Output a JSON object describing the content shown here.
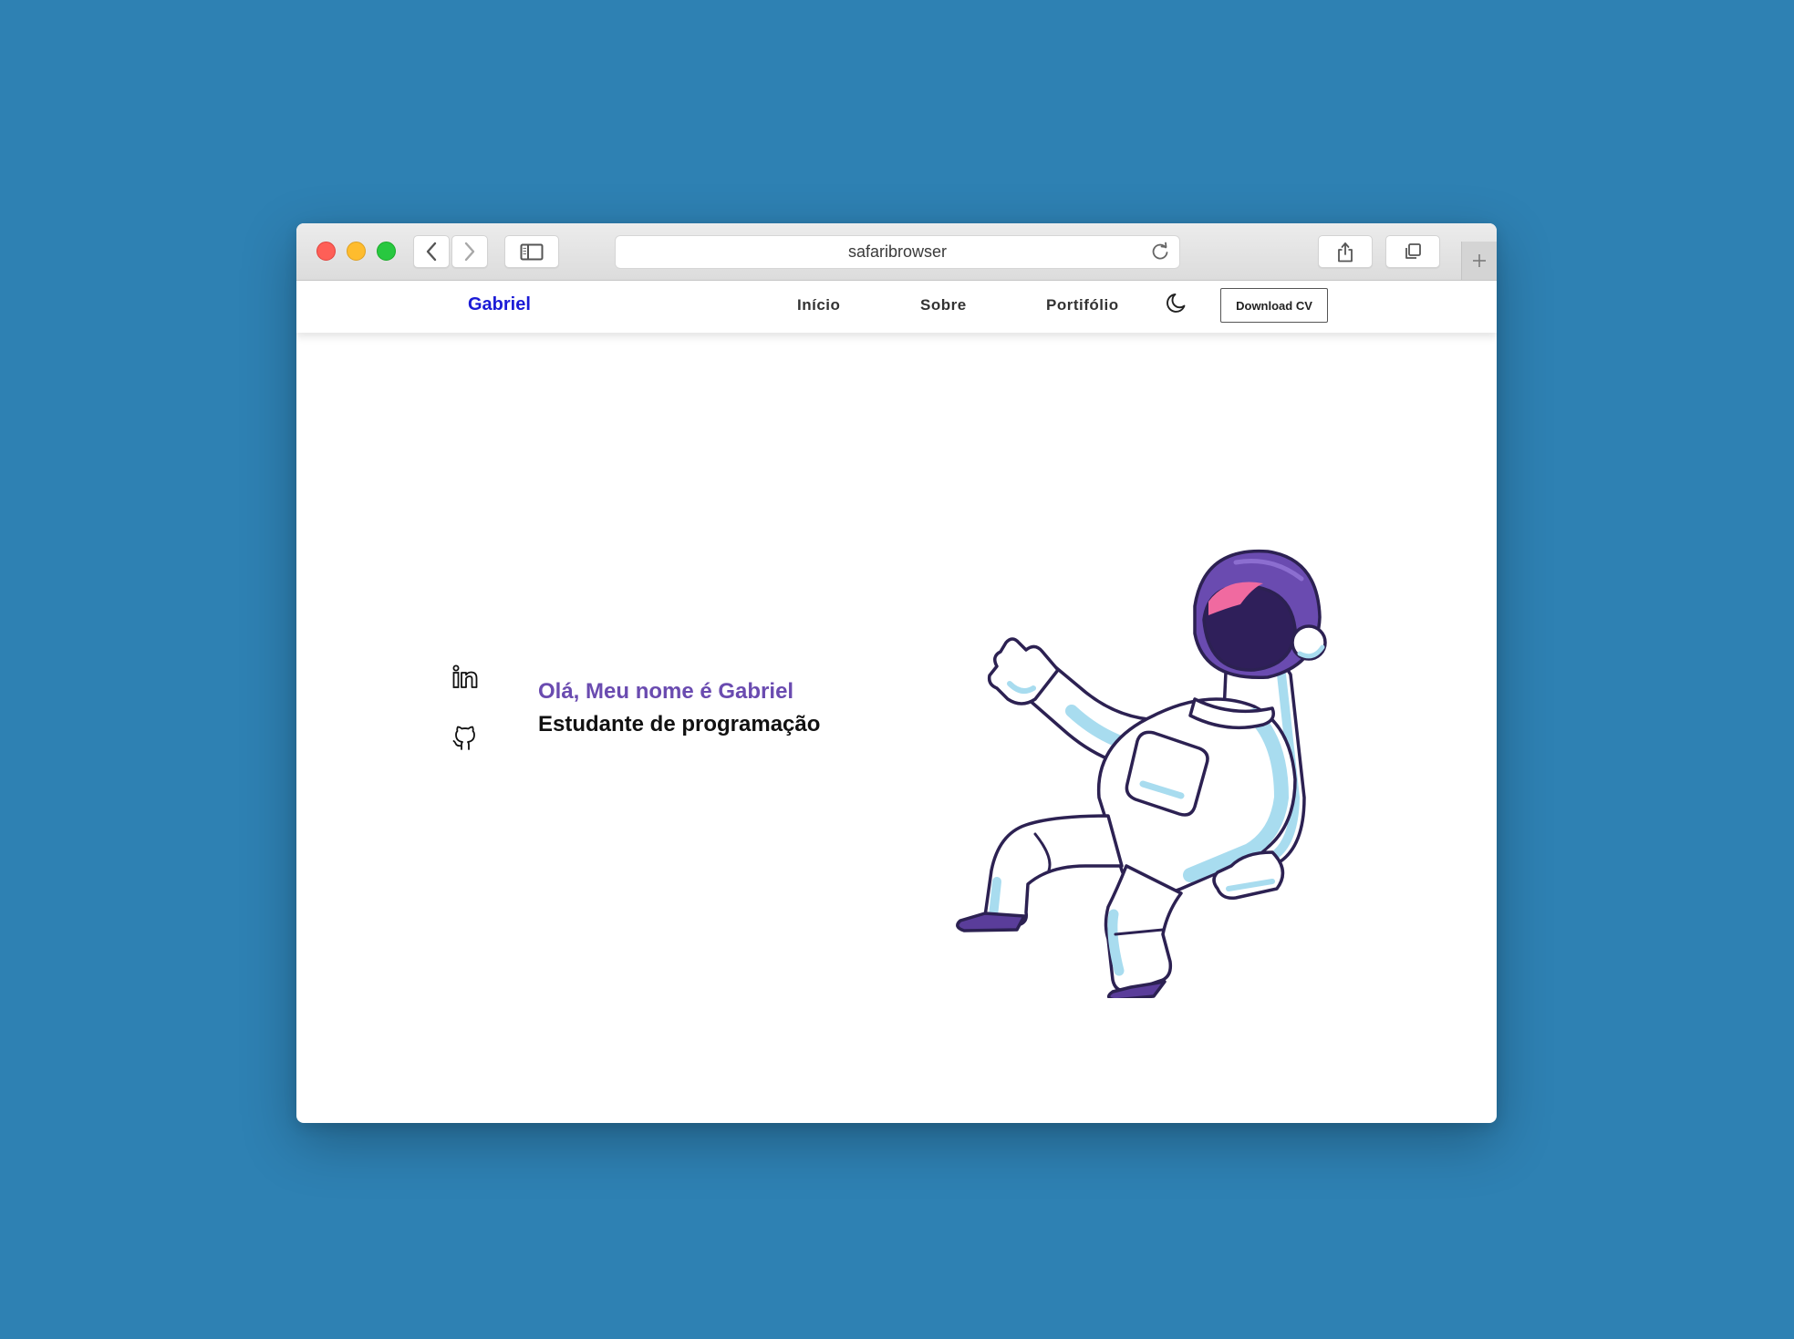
{
  "browser": {
    "url": "safaribrowser"
  },
  "site": {
    "logo": "Gabriel",
    "nav": [
      {
        "label": "Início"
      },
      {
        "label": "Sobre"
      },
      {
        "label": "Portifólio"
      }
    ],
    "cv_button": "Download CV"
  },
  "hero": {
    "greeting": "Olá, Meu nome é Gabriel",
    "subtitle": "Estudante de programação"
  },
  "icons": {
    "social": [
      "linkedin-icon",
      "github-icon"
    ],
    "theme_toggle": "moon-icon",
    "illustration": "astronaut-illustration"
  },
  "colors": {
    "page_background": "#2e81b3",
    "logo": "#1b1bd6",
    "greeting": "#6a4bb0",
    "helmet": "#6a4bb0",
    "suit_shade": "#a8dcef"
  }
}
